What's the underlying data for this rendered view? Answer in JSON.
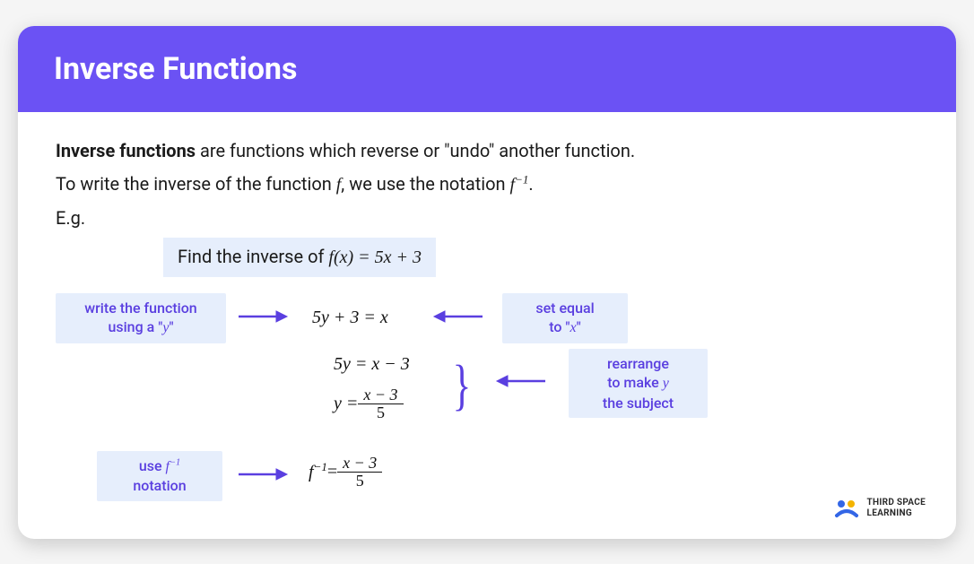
{
  "header": {
    "title": "Inverse Functions"
  },
  "intro": {
    "strong": "Inverse functions",
    "line1_rest": " are functions which reverse or \"undo\" another function.",
    "line2_a": "To write the inverse of the function ",
    "line2_f": "f",
    "line2_b": ", we use the notation ",
    "line2_finv_base": "f",
    "line2_finv_sup": "−1",
    "line2_c": ".",
    "eg": "E.g."
  },
  "example": {
    "prompt_a": "Find the inverse of ",
    "prompt_fx": "f(x) = 5x + 3"
  },
  "hints": {
    "left1_a": "write the function",
    "left1_b": "using a \"",
    "left1_var": "y",
    "left1_c": "\"",
    "right1_a": "set equal",
    "right1_b": "to \"",
    "right1_var": "x",
    "right1_c": "\"",
    "right2_a": "rearrange",
    "right2_b": "to make ",
    "right2_var": "y",
    "right2_c": "the subject",
    "left2_a": "use ",
    "left2_var_base": "f",
    "left2_var_sup": "−1",
    "left2_b": "notation"
  },
  "equations": {
    "eq1": "5y + 3 = x",
    "eq2": "5y = x − 3",
    "eq3_lhs": "y = ",
    "eq3_num": "x − 3",
    "eq3_den": "5",
    "eq4_lhs_base": "f",
    "eq4_lhs_sup": "−1",
    "eq4_eq": " = ",
    "eq4_num": "x − 3",
    "eq4_den": "5"
  },
  "brand": {
    "line1": "THIRD SPACE",
    "line2": "LEARNING"
  }
}
